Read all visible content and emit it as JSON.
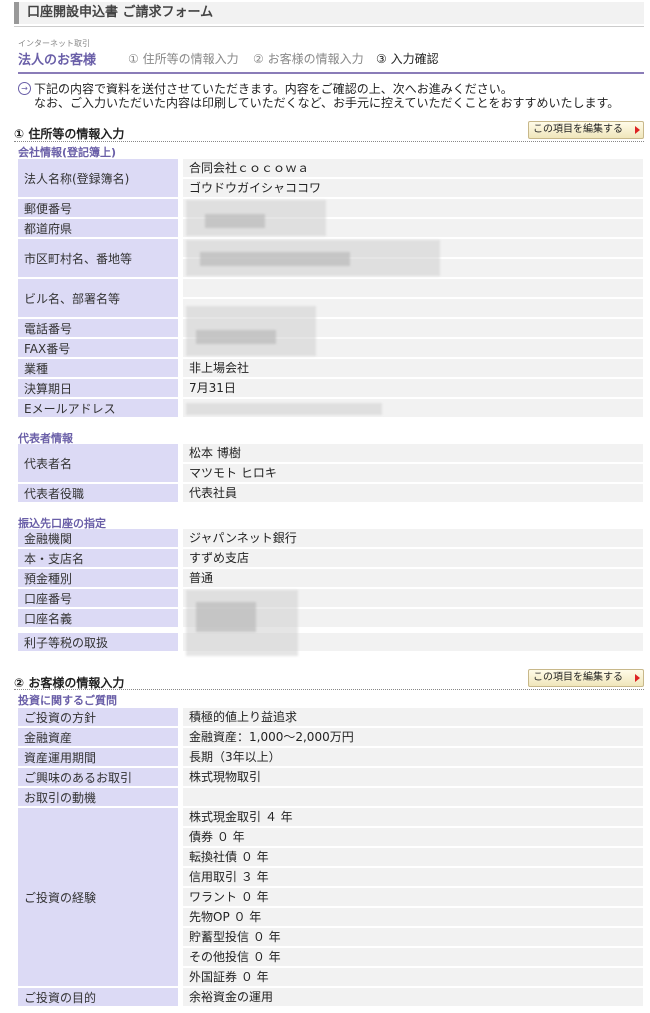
{
  "page_title": "口座開設申込書 ご請求フォーム",
  "header": {
    "subtitle": "インターネット取引",
    "title": "法人のお客様",
    "steps": [
      "① 住所等の情報入力",
      "② お客様の情報入力",
      "③ 入力確認"
    ]
  },
  "intro": {
    "line1": "下記の内容で資料を送付させていただきます。内容をご確認の上、次へお進みください。",
    "line2": "なお、ご入力いただいた内容は印刷していただくなど、お手元に控えていただくことをおすすめいたします。"
  },
  "edit_button_label": "この項目を編集する",
  "section1": {
    "title": "① 住所等の情報入力",
    "company": {
      "heading": "会社情報(登記簿上)",
      "name_label": "法人名称(登録簿名)",
      "name_value": "合同会社ｃｏｃｏｗａ",
      "name_kana": "ゴウドウガイシャココワ",
      "postal_label": "郵便番号",
      "pref_label": "都道府県",
      "city_label": "市区町村名、番地等",
      "building_label": "ビル名、部署名等",
      "tel_label": "電話番号",
      "fax_label": "FAX番号",
      "industry_label": "業種",
      "industry_value": "非上場会社",
      "fiscal_label": "決算期日",
      "fiscal_value": "7月31日",
      "email_label": "Eメールアドレス"
    },
    "rep": {
      "heading": "代表者情報",
      "name_label": "代表者名",
      "name_value": "松本 博樹",
      "name_kana": "マツモト ヒロキ",
      "role_label": "代表者役職",
      "role_value": "代表社員"
    },
    "bank": {
      "heading": "振込先口座の指定",
      "inst_label": "金融機関",
      "inst_value": "ジャパンネット銀行",
      "branch_label": "本・支店名",
      "branch_value": "すずめ支店",
      "type_label": "預金種別",
      "type_value": "普通",
      "number_label": "口座番号",
      "holder_label": "口座名義",
      "tax_label": "利子等税の取扱"
    }
  },
  "section2": {
    "title": "② お客様の情報入力",
    "heading": "投資に関するご質問",
    "policy_label": "ご投資の方針",
    "policy_value": "積極的値上り益追求",
    "assets_label": "金融資産",
    "assets_value": "金融資産：1,000〜2,000万円",
    "period_label": "資産運用期間",
    "period_value": "長期（3年以上）",
    "interest_label": "ご興味のあるお取引",
    "interest_value": "株式現物取引",
    "motive_label": "お取引の動機",
    "experience_label": "ご投資の経験",
    "experience": [
      "株式現金取引 ４ 年",
      "債券 ０ 年",
      "転換社債 ０ 年",
      "信用取引 ３ 年",
      "ワラント ０ 年",
      "先物OP ０ 年",
      "貯蓄型投信 ０ 年",
      "その他投信 ０ 年",
      "外国証券 ０ 年"
    ],
    "purpose_label": "ご投資の目的",
    "purpose_value": "余裕資金の運用"
  },
  "colors": {
    "accent": "#6a5fa8",
    "label_bg": "#dcdaf5",
    "value_bg": "#f2f2f2"
  }
}
